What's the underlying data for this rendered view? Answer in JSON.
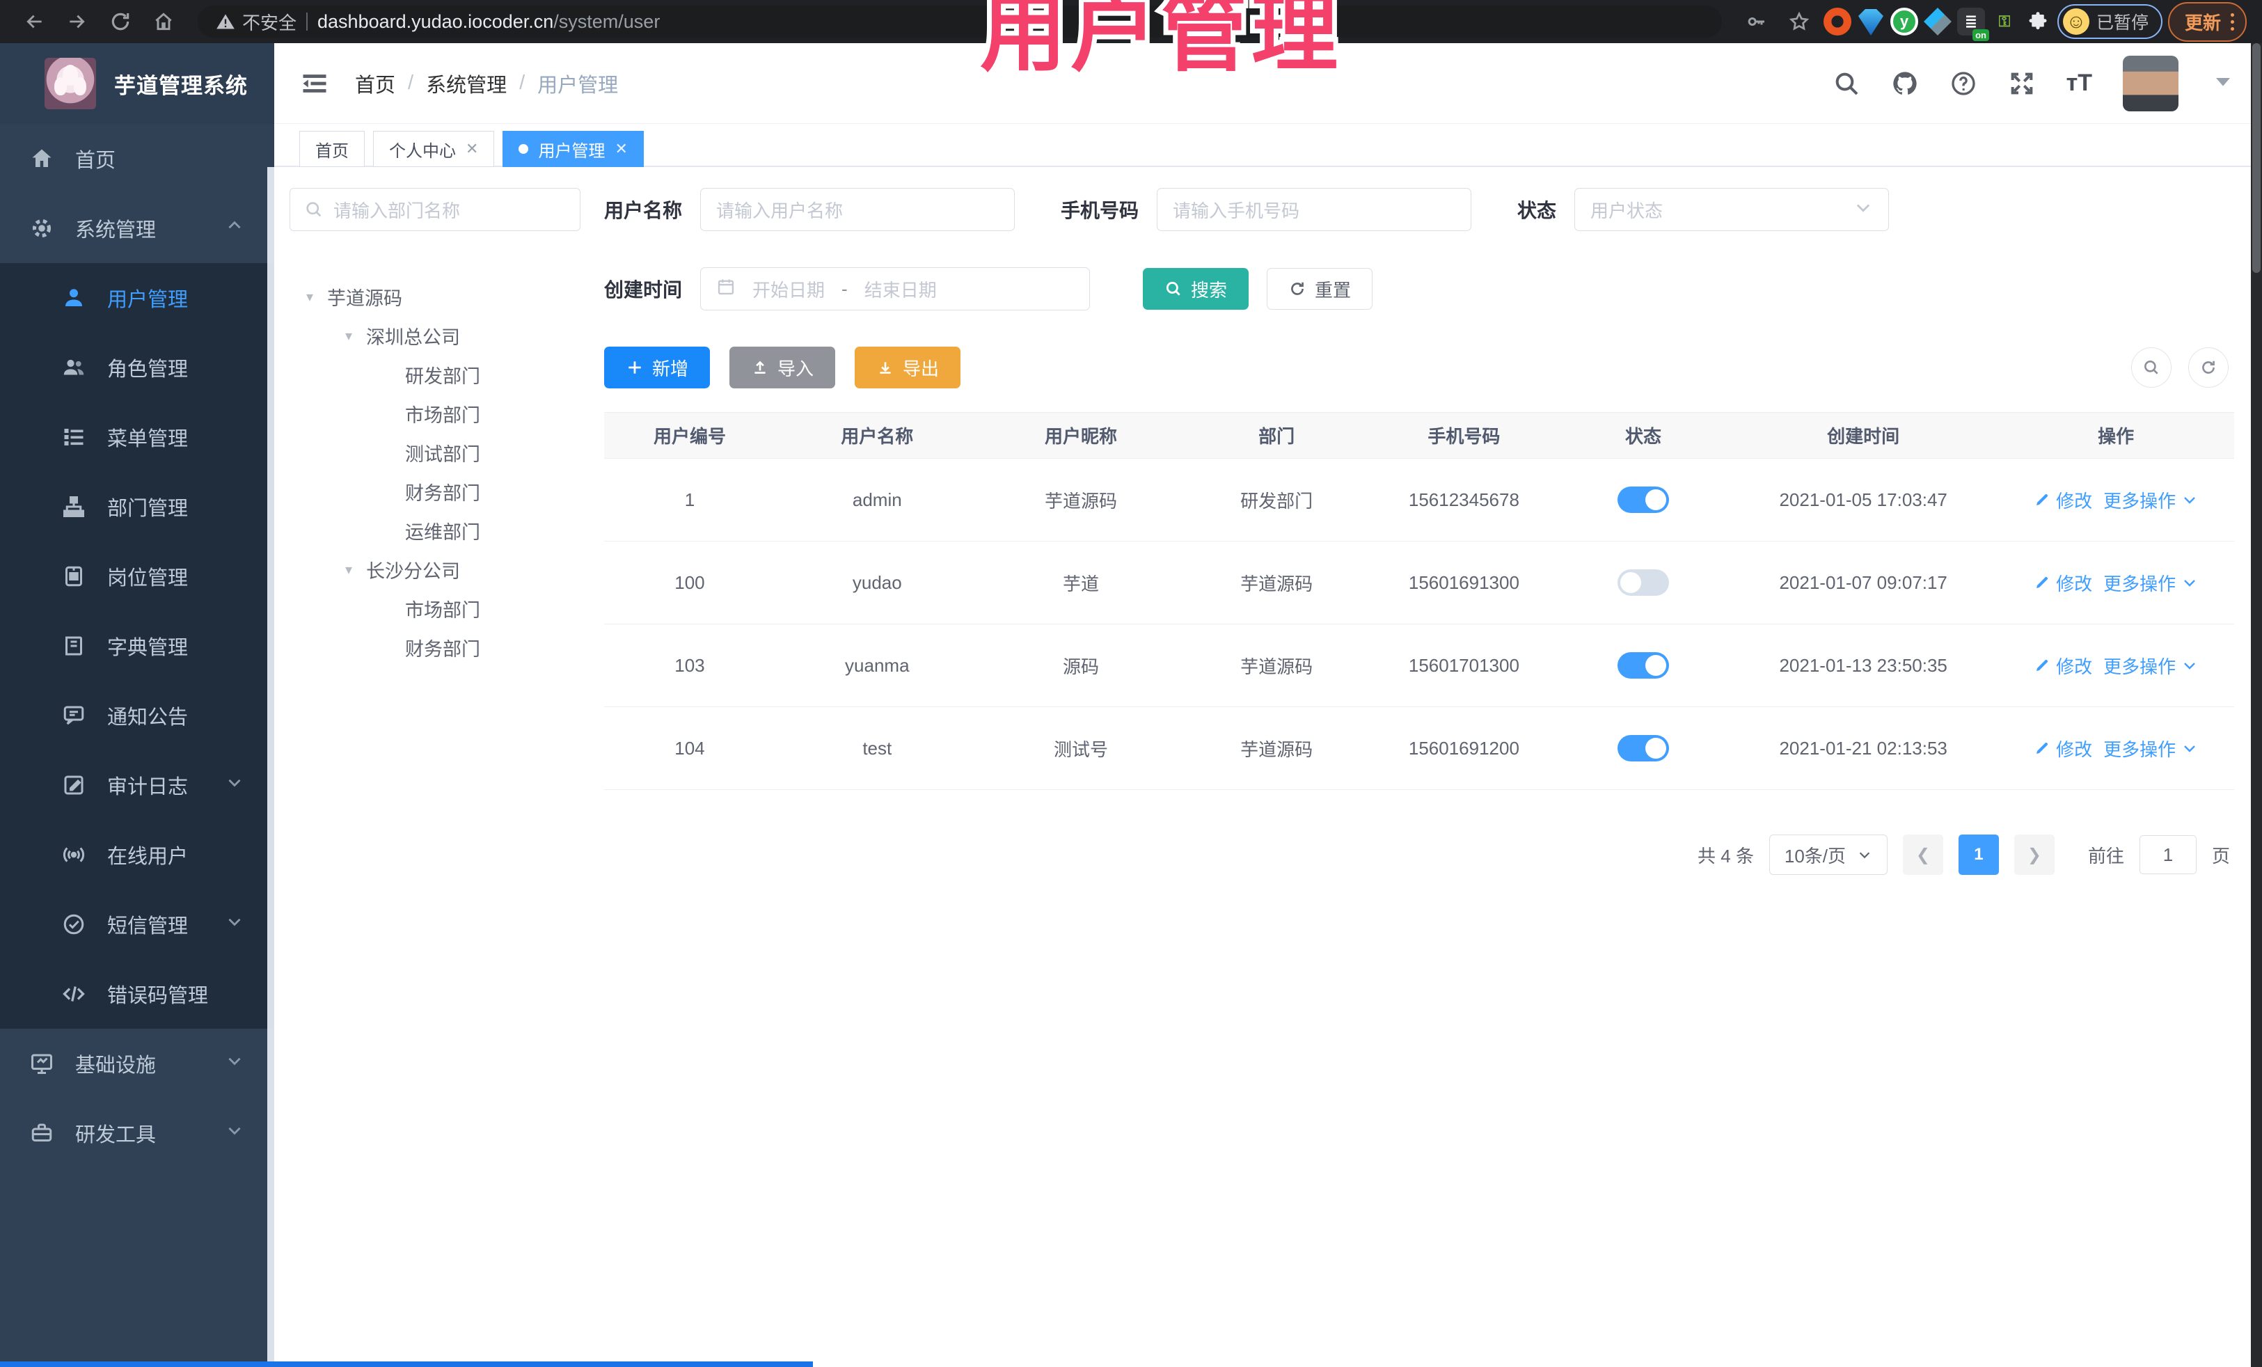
{
  "browser": {
    "security_label": "不安全",
    "url_host": "dashboard.yudao.iocoder.cn",
    "url_path": "/system/user",
    "extension_badge": "on",
    "profile_status": "已暂停",
    "update_label": "更新"
  },
  "overlay": {
    "title": "用户管理",
    "color": "#f4416c"
  },
  "header": {
    "app_title": "芋道管理系统",
    "breadcrumb": {
      "home": "首页",
      "section": "系统管理",
      "page": "用户管理"
    }
  },
  "tabs": [
    {
      "label": "首页"
    },
    {
      "label": "个人中心"
    },
    {
      "label": "用户管理"
    }
  ],
  "sidebar": {
    "items": [
      {
        "label": "首页"
      },
      {
        "label": "系统管理"
      },
      {
        "label": "用户管理"
      },
      {
        "label": "角色管理"
      },
      {
        "label": "菜单管理"
      },
      {
        "label": "部门管理"
      },
      {
        "label": "岗位管理"
      },
      {
        "label": "字典管理"
      },
      {
        "label": "通知公告"
      },
      {
        "label": "审计日志"
      },
      {
        "label": "在线用户"
      },
      {
        "label": "短信管理"
      },
      {
        "label": "错误码管理"
      },
      {
        "label": "基础设施"
      },
      {
        "label": "研发工具"
      }
    ]
  },
  "dept_panel": {
    "search_placeholder": "请输入部门名称",
    "tree": [
      {
        "label": "芋道源码"
      },
      {
        "label": "深圳总公司"
      },
      {
        "label": "研发部门"
      },
      {
        "label": "市场部门"
      },
      {
        "label": "测试部门"
      },
      {
        "label": "财务部门"
      },
      {
        "label": "运维部门"
      },
      {
        "label": "长沙分公司"
      },
      {
        "label": "市场部门"
      },
      {
        "label": "财务部门"
      }
    ]
  },
  "filters": {
    "username_label": "用户名称",
    "username_placeholder": "请输入用户名称",
    "mobile_label": "手机号码",
    "mobile_placeholder": "请输入手机号码",
    "status_label": "状态",
    "status_placeholder": "用户状态",
    "create_time_label": "创建时间",
    "date_start_placeholder": "开始日期",
    "date_separator": "-",
    "date_end_placeholder": "结束日期",
    "search_label": "搜索",
    "reset_label": "重置"
  },
  "toolbar": {
    "add_label": "新增",
    "import_label": "导入",
    "export_label": "导出"
  },
  "table": {
    "columns": [
      "用户编号",
      "用户名称",
      "用户昵称",
      "部门",
      "手机号码",
      "状态",
      "创建时间",
      "操作"
    ],
    "edit_label": "修改",
    "more_label": "更多操作",
    "rows": [
      {
        "id": "1",
        "username": "admin",
        "nickname": "芋道源码",
        "dept": "研发部门",
        "mobile": "15612345678",
        "status": "on",
        "created": "2021-01-05 17:03:47"
      },
      {
        "id": "100",
        "username": "yudao",
        "nickname": "芋道",
        "dept": "芋道源码",
        "mobile": "15601691300",
        "status": "off",
        "created": "2021-01-07 09:07:17"
      },
      {
        "id": "103",
        "username": "yuanma",
        "nickname": "源码",
        "dept": "芋道源码",
        "mobile": "15601701300",
        "status": "on",
        "created": "2021-01-13 23:50:35"
      },
      {
        "id": "104",
        "username": "test",
        "nickname": "测试号",
        "dept": "芋道源码",
        "mobile": "15601691200",
        "status": "on",
        "created": "2021-01-21 02:13:53"
      }
    ]
  },
  "pagination": {
    "total_text": "共 4 条",
    "page_size": "10条/页",
    "current_page": "1",
    "goto_label": "前往",
    "goto_value": "1",
    "page_suffix": "页"
  },
  "colors": {
    "accent_blue": "#409eff",
    "primary_button": "#1989fa",
    "teal_button": "#2ab3a3",
    "warning_button": "#f0a73c",
    "info_button": "#909399",
    "sidebar_bg": "#304156",
    "submenu_bg": "#1f2d3d",
    "overlay_pink": "#f4416c"
  }
}
